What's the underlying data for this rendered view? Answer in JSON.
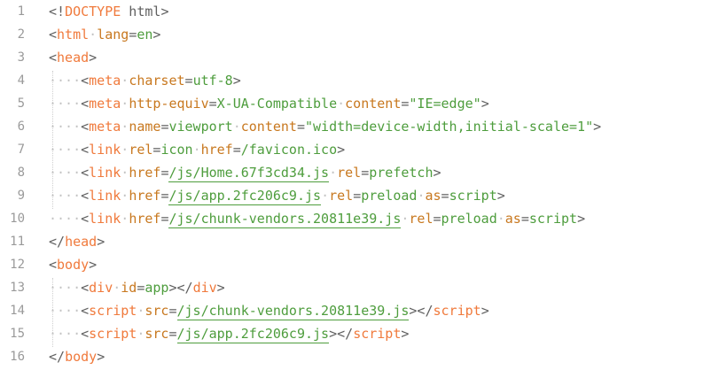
{
  "editor": {
    "lines": [
      {
        "num": "1",
        "indent": 0,
        "tokens": [
          {
            "t": "<!",
            "c": "p"
          },
          {
            "t": "DOCTYPE",
            "c": "doctype"
          },
          {
            "t": " html",
            "c": "p"
          },
          {
            "t": ">",
            "c": "p"
          }
        ]
      },
      {
        "num": "2",
        "indent": 0,
        "tokens": [
          {
            "t": "<",
            "c": "p"
          },
          {
            "t": "html",
            "c": "tag"
          },
          {
            "t": "·",
            "c": "ws"
          },
          {
            "t": "lang",
            "c": "attr"
          },
          {
            "t": "=",
            "c": "p"
          },
          {
            "t": "en",
            "c": "val"
          },
          {
            "t": ">",
            "c": "p"
          }
        ]
      },
      {
        "num": "3",
        "indent": 0,
        "tokens": [
          {
            "t": "<",
            "c": "p"
          },
          {
            "t": "head",
            "c": "tag"
          },
          {
            "t": ">",
            "c": "p"
          }
        ]
      },
      {
        "num": "4",
        "indent": 1,
        "tokens": [
          {
            "t": "<",
            "c": "p"
          },
          {
            "t": "meta",
            "c": "tag"
          },
          {
            "t": "·",
            "c": "ws"
          },
          {
            "t": "charset",
            "c": "attr"
          },
          {
            "t": "=",
            "c": "p"
          },
          {
            "t": "utf-8",
            "c": "val"
          },
          {
            "t": ">",
            "c": "p"
          }
        ]
      },
      {
        "num": "5",
        "indent": 1,
        "tokens": [
          {
            "t": "<",
            "c": "p"
          },
          {
            "t": "meta",
            "c": "tag"
          },
          {
            "t": "·",
            "c": "ws"
          },
          {
            "t": "http-equiv",
            "c": "attr"
          },
          {
            "t": "=",
            "c": "p"
          },
          {
            "t": "X-UA-Compatible",
            "c": "val"
          },
          {
            "t": "·",
            "c": "ws"
          },
          {
            "t": "content",
            "c": "attr"
          },
          {
            "t": "=",
            "c": "p"
          },
          {
            "t": "\"IE=edge\"",
            "c": "val"
          },
          {
            "t": ">",
            "c": "p"
          }
        ]
      },
      {
        "num": "6",
        "indent": 1,
        "tokens": [
          {
            "t": "<",
            "c": "p"
          },
          {
            "t": "meta",
            "c": "tag"
          },
          {
            "t": "·",
            "c": "ws"
          },
          {
            "t": "name",
            "c": "attr"
          },
          {
            "t": "=",
            "c": "p"
          },
          {
            "t": "viewport",
            "c": "val"
          },
          {
            "t": "·",
            "c": "ws"
          },
          {
            "t": "content",
            "c": "attr"
          },
          {
            "t": "=",
            "c": "p"
          },
          {
            "t": "\"width=device-width,initial-scale=1\"",
            "c": "val"
          },
          {
            "t": ">",
            "c": "p"
          }
        ]
      },
      {
        "num": "7",
        "indent": 1,
        "tokens": [
          {
            "t": "<",
            "c": "p"
          },
          {
            "t": "link",
            "c": "tag"
          },
          {
            "t": "·",
            "c": "ws"
          },
          {
            "t": "rel",
            "c": "attr"
          },
          {
            "t": "=",
            "c": "p"
          },
          {
            "t": "icon",
            "c": "val"
          },
          {
            "t": "·",
            "c": "ws"
          },
          {
            "t": "href",
            "c": "attr"
          },
          {
            "t": "=",
            "c": "p"
          },
          {
            "t": "/favicon.ico",
            "c": "val"
          },
          {
            "t": ">",
            "c": "p"
          }
        ]
      },
      {
        "num": "8",
        "indent": 1,
        "tokens": [
          {
            "t": "<",
            "c": "p"
          },
          {
            "t": "link",
            "c": "tag"
          },
          {
            "t": "·",
            "c": "ws"
          },
          {
            "t": "href",
            "c": "attr"
          },
          {
            "t": "=",
            "c": "p"
          },
          {
            "t": "/js/Home.67f3cd34.js",
            "c": "link"
          },
          {
            "t": "·",
            "c": "ws"
          },
          {
            "t": "rel",
            "c": "attr"
          },
          {
            "t": "=",
            "c": "p"
          },
          {
            "t": "prefetch",
            "c": "val"
          },
          {
            "t": ">",
            "c": "p"
          }
        ]
      },
      {
        "num": "9",
        "indent": 1,
        "tokens": [
          {
            "t": "<",
            "c": "p"
          },
          {
            "t": "link",
            "c": "tag"
          },
          {
            "t": "·",
            "c": "ws"
          },
          {
            "t": "href",
            "c": "attr"
          },
          {
            "t": "=",
            "c": "p"
          },
          {
            "t": "/js/app.2fc206c9.js",
            "c": "link"
          },
          {
            "t": "·",
            "c": "ws"
          },
          {
            "t": "rel",
            "c": "attr"
          },
          {
            "t": "=",
            "c": "p"
          },
          {
            "t": "preload",
            "c": "val"
          },
          {
            "t": "·",
            "c": "ws"
          },
          {
            "t": "as",
            "c": "attr"
          },
          {
            "t": "=",
            "c": "p"
          },
          {
            "t": "script",
            "c": "val"
          },
          {
            "t": ">",
            "c": "p"
          }
        ]
      },
      {
        "num": "10",
        "indent": 1,
        "tokens": [
          {
            "t": "<",
            "c": "p"
          },
          {
            "t": "link",
            "c": "tag"
          },
          {
            "t": "·",
            "c": "ws"
          },
          {
            "t": "href",
            "c": "attr"
          },
          {
            "t": "=",
            "c": "p"
          },
          {
            "t": "/js/chunk-vendors.20811e39.js",
            "c": "link"
          },
          {
            "t": "·",
            "c": "ws"
          },
          {
            "t": "rel",
            "c": "attr"
          },
          {
            "t": "=",
            "c": "p"
          },
          {
            "t": "preload",
            "c": "val"
          },
          {
            "t": "·",
            "c": "ws"
          },
          {
            "t": "as",
            "c": "attr"
          },
          {
            "t": "=",
            "c": "p"
          },
          {
            "t": "script",
            "c": "val"
          },
          {
            "t": ">",
            "c": "p"
          }
        ]
      },
      {
        "num": "11",
        "indent": 0,
        "tokens": [
          {
            "t": "</",
            "c": "p"
          },
          {
            "t": "head",
            "c": "tag"
          },
          {
            "t": ">",
            "c": "p"
          }
        ]
      },
      {
        "num": "12",
        "indent": 0,
        "tokens": [
          {
            "t": "<",
            "c": "p"
          },
          {
            "t": "body",
            "c": "tag"
          },
          {
            "t": ">",
            "c": "p"
          }
        ]
      },
      {
        "num": "13",
        "indent": 1,
        "tokens": [
          {
            "t": "<",
            "c": "p"
          },
          {
            "t": "div",
            "c": "tag"
          },
          {
            "t": "·",
            "c": "ws"
          },
          {
            "t": "id",
            "c": "attr"
          },
          {
            "t": "=",
            "c": "p"
          },
          {
            "t": "app",
            "c": "val"
          },
          {
            "t": "></",
            "c": "p"
          },
          {
            "t": "div",
            "c": "tag"
          },
          {
            "t": ">",
            "c": "p"
          }
        ]
      },
      {
        "num": "14",
        "indent": 1,
        "tokens": [
          {
            "t": "<",
            "c": "p"
          },
          {
            "t": "script",
            "c": "tag"
          },
          {
            "t": "·",
            "c": "ws"
          },
          {
            "t": "src",
            "c": "attr"
          },
          {
            "t": "=",
            "c": "p"
          },
          {
            "t": "/js/chunk-vendors.20811e39.js",
            "c": "link"
          },
          {
            "t": "></",
            "c": "p"
          },
          {
            "t": "script",
            "c": "tag"
          },
          {
            "t": ">",
            "c": "p"
          }
        ]
      },
      {
        "num": "15",
        "indent": 1,
        "tokens": [
          {
            "t": "<",
            "c": "p"
          },
          {
            "t": "script",
            "c": "tag"
          },
          {
            "t": "·",
            "c": "ws"
          },
          {
            "t": "src",
            "c": "attr"
          },
          {
            "t": "=",
            "c": "p"
          },
          {
            "t": "/js/app.2fc206c9.js",
            "c": "link"
          },
          {
            "t": "></",
            "c": "p"
          },
          {
            "t": "script",
            "c": "tag"
          },
          {
            "t": ">",
            "c": "p"
          }
        ]
      },
      {
        "num": "16",
        "indent": 0,
        "tokens": [
          {
            "t": "</",
            "c": "p"
          },
          {
            "t": "body",
            "c": "tag"
          },
          {
            "t": ">",
            "c": "p"
          }
        ]
      }
    ],
    "indent_marker": "····",
    "colors": {
      "tag": "#f07a3c",
      "attribute": "#c8781f",
      "value": "#4e9d3d",
      "punctuation": "#5f5f5f",
      "line_number": "#9a9a9a",
      "whitespace": "#c4c4c4"
    }
  }
}
